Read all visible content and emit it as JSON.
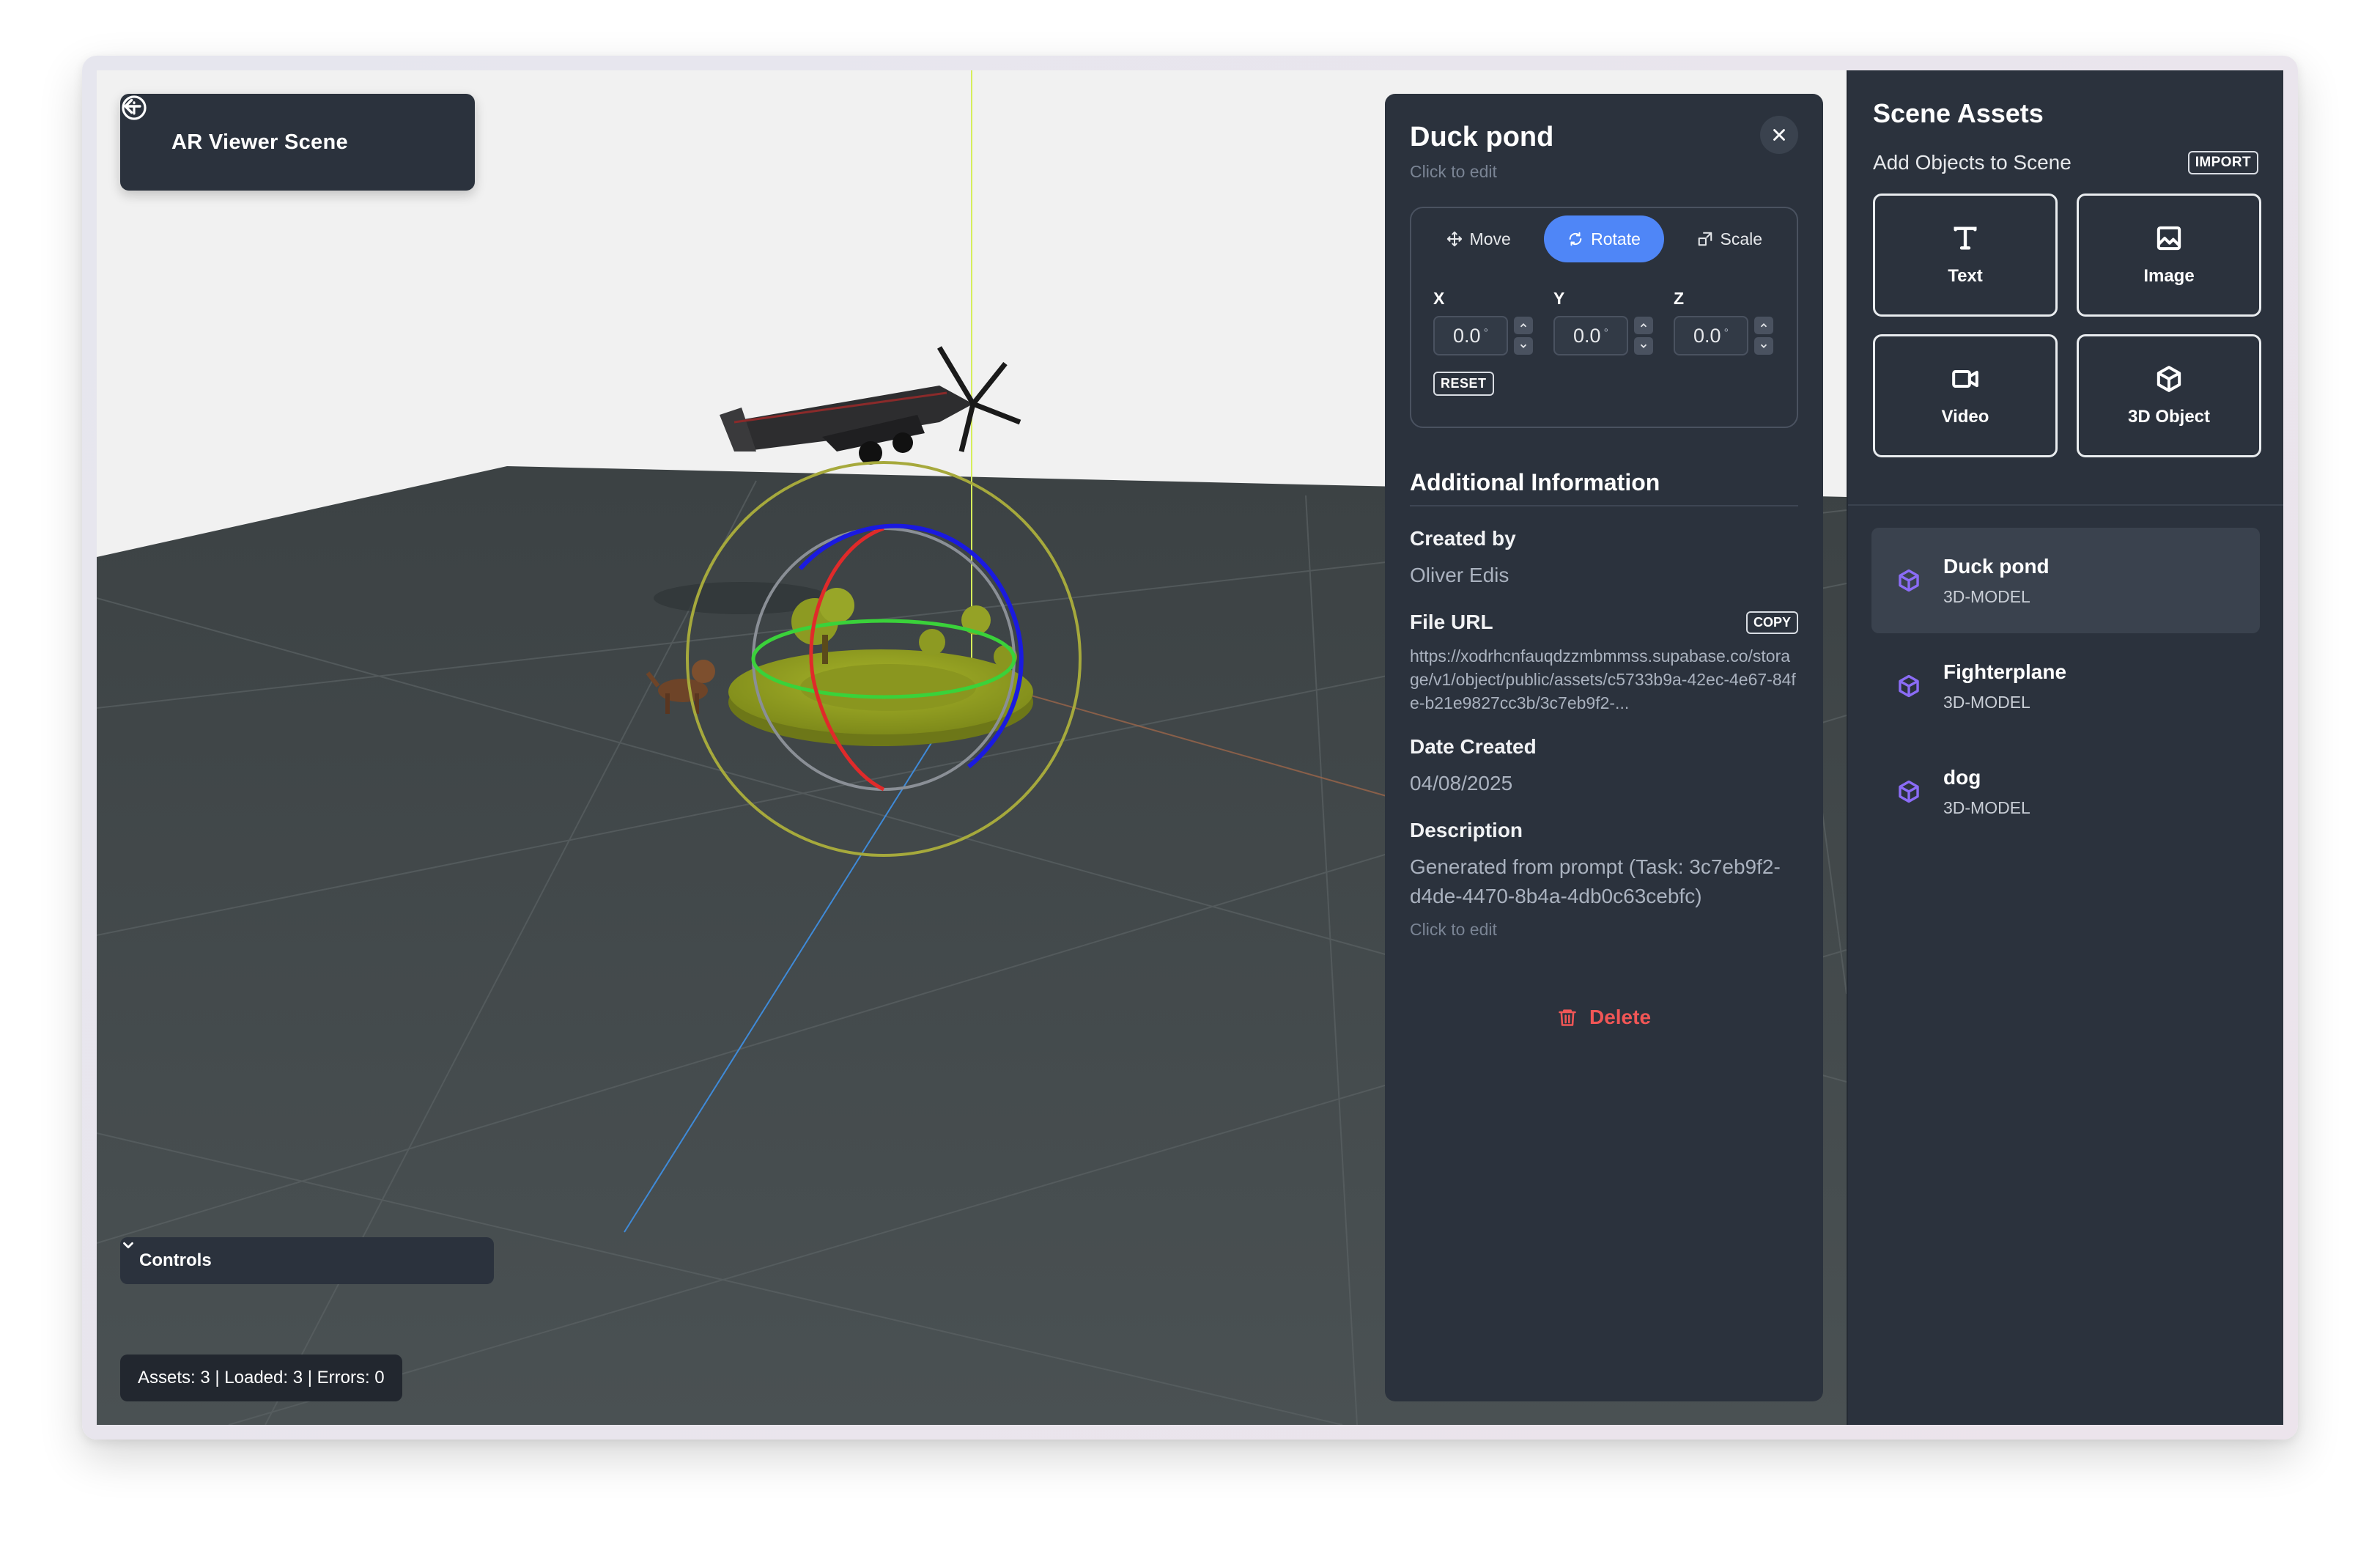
{
  "header": {
    "title": "AR Viewer Scene"
  },
  "controls": {
    "label": "Controls"
  },
  "status": {
    "text": "Assets: 3 | Loaded: 3 | Errors: 0"
  },
  "object_panel": {
    "name": "Duck pond",
    "name_hint": "Click to edit",
    "modes": [
      "Move",
      "Rotate",
      "Scale"
    ],
    "active_mode": "Rotate",
    "axes": [
      {
        "label": "X",
        "value": "0.0",
        "unit": "°"
      },
      {
        "label": "Y",
        "value": "0.0",
        "unit": "°"
      },
      {
        "label": "Z",
        "value": "0.0",
        "unit": "°"
      }
    ],
    "reset_label": "RESET",
    "info_title": "Additional Information",
    "created_by_label": "Created by",
    "created_by": "Oliver Edis",
    "file_url_label": "File URL",
    "copy_label": "COPY",
    "file_url": "https://xodrhcnfauqdzzmbmmss.supabase.co/storage/v1/object/public/assets/c5733b9a-42ec-4e67-84fe-b21e9827cc3b/3c7eb9f2-...",
    "date_label": "Date Created",
    "date": "04/08/2025",
    "description_label": "Description",
    "description": "Generated from prompt (Task: 3c7eb9f2-d4de-4470-8b4a-4db0c63cebfc)",
    "description_hint": "Click to edit",
    "delete_label": "Delete"
  },
  "assets_panel": {
    "title": "Scene Assets",
    "add_label": "Add Objects to Scene",
    "import_label": "IMPORT",
    "tiles": [
      {
        "label": "Text",
        "icon": "text-icon"
      },
      {
        "label": "Image",
        "icon": "image-icon"
      },
      {
        "label": "Video",
        "icon": "video-icon"
      },
      {
        "label": "3D Object",
        "icon": "cube-icon"
      }
    ],
    "items": [
      {
        "name": "Duck pond",
        "type": "3D-MODEL",
        "selected": true
      },
      {
        "name": "Fighterplane",
        "type": "3D-MODEL",
        "selected": false
      },
      {
        "name": "dog",
        "type": "3D-MODEL",
        "selected": false
      }
    ]
  },
  "colors": {
    "panel": "#2b323d",
    "accent": "#4f86f7",
    "danger": "#f15656",
    "asset_icon": "#8b6cf6"
  }
}
